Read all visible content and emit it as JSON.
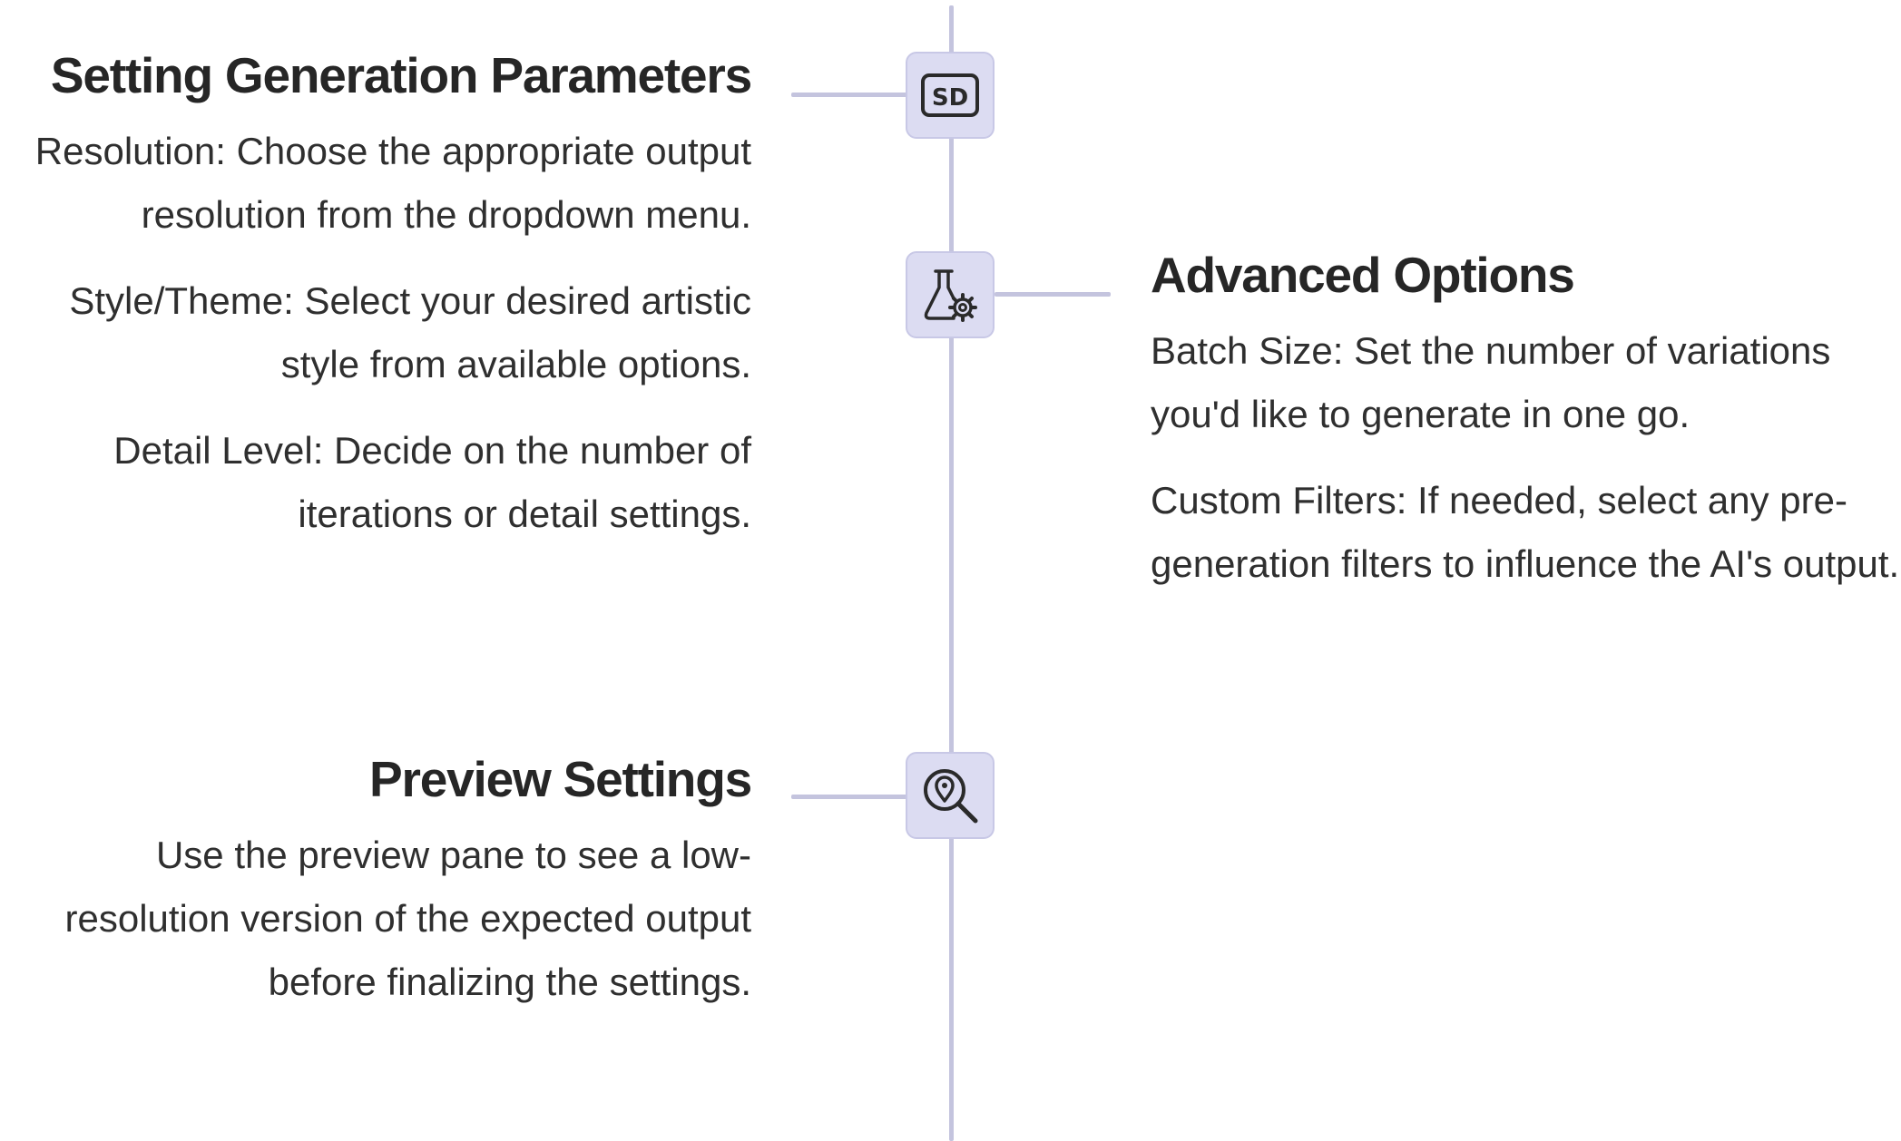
{
  "sections": [
    {
      "id": "generation",
      "side": "left",
      "icon": "sd-badge-icon",
      "title": "Setting Generation Parameters",
      "paragraphs": [
        "Resolution: Choose the appropriate output resolution from the dropdown menu.",
        "Style/Theme: Select your desired artistic style from available options.",
        "Detail Level: Decide on the number of iterations or detail settings."
      ]
    },
    {
      "id": "advanced",
      "side": "right",
      "icon": "flask-gear-icon",
      "title": "Advanced Options",
      "paragraphs": [
        "Batch Size: Set the number of variations you'd like to generate in one go.",
        "Custom Filters: If needed, select any pre-generation filters to influence the AI's output."
      ]
    },
    {
      "id": "preview",
      "side": "left",
      "icon": "search-location-icon",
      "title": "Preview Settings",
      "paragraphs": [
        "Use the preview pane to see a low-resolution version of the expected output before finalizing the settings."
      ]
    }
  ],
  "colors": {
    "line": "#c4c4de",
    "icon_bg": "#dcdcf2",
    "icon_stroke": "#2a2a2a",
    "heading": "#262626",
    "body_text": "#2f2f2f"
  }
}
